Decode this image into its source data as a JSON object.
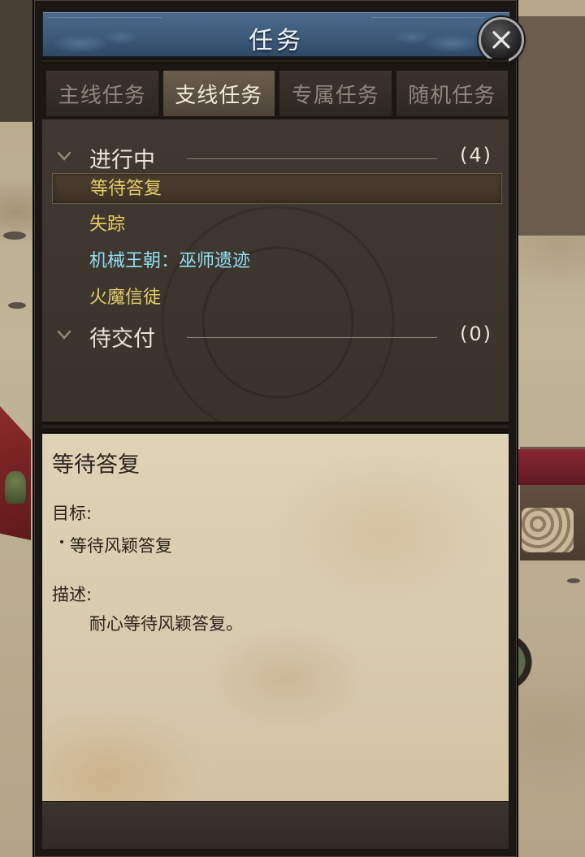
{
  "window": {
    "title": "任务",
    "close_label": "close"
  },
  "tabs": [
    {
      "label": "主线任务",
      "active": false
    },
    {
      "label": "支线任务",
      "active": true
    },
    {
      "label": "专属任务",
      "active": false
    },
    {
      "label": "随机任务",
      "active": false
    }
  ],
  "sections": {
    "in_progress": {
      "label": "进行中",
      "count": "(4)"
    },
    "pending": {
      "label": "待交付",
      "count": "(0)"
    }
  },
  "quests": [
    {
      "name": "等待答复",
      "selected": true
    },
    {
      "name": "失踪",
      "selected": false
    },
    {
      "name": "机械王朝：巫师遗迹",
      "selected": false
    },
    {
      "name": "火魔信徒",
      "selected": false
    }
  ],
  "detail": {
    "title": "等待答复",
    "goal_label": "目标:",
    "goal_item": "等待风颖答复",
    "desc_label": "描述:",
    "desc_text": "耐心等待风颖答复。"
  },
  "colors": {
    "title_bar": "#3d5a7a",
    "quest_text": "#e3cd69",
    "special_quest_text": "#8fe0f0",
    "parchment": "#d9cbb0"
  },
  "icons": {
    "close": "close-icon",
    "chevron": "chevron-down-icon"
  }
}
